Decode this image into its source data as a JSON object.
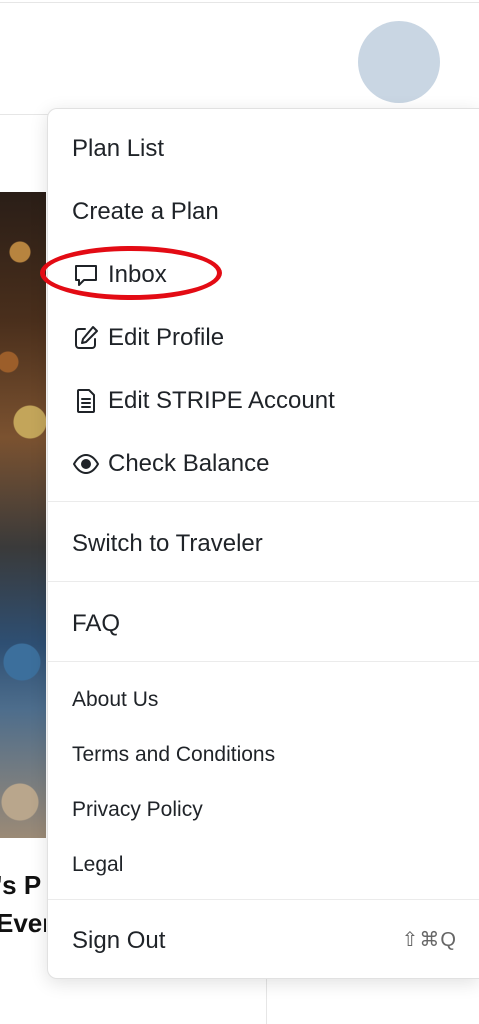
{
  "header": {
    "avatar_alt": "User avatar"
  },
  "background": {
    "card_title": "'s P\nEver"
  },
  "menu": {
    "items": [
      {
        "label": "Plan List"
      },
      {
        "label": "Create a Plan"
      },
      {
        "label": "Inbox",
        "icon": "chat-bubble-icon"
      },
      {
        "label": "Edit Profile",
        "icon": "edit-icon"
      },
      {
        "label": "Edit STRIPE Account",
        "icon": "document-icon"
      },
      {
        "label": "Check Balance",
        "icon": "eye-icon"
      }
    ],
    "switch_label": "Switch to Traveler",
    "faq_label": "FAQ",
    "info_links": [
      {
        "label": "About Us"
      },
      {
        "label": "Terms and Conditions"
      },
      {
        "label": "Privacy Policy"
      },
      {
        "label": "Legal"
      }
    ],
    "sign_out_label": "Sign Out",
    "sign_out_shortcut": "⇧⌘Q"
  },
  "colors": {
    "highlight": "#e30b14",
    "avatar": "#c9d6e3"
  }
}
